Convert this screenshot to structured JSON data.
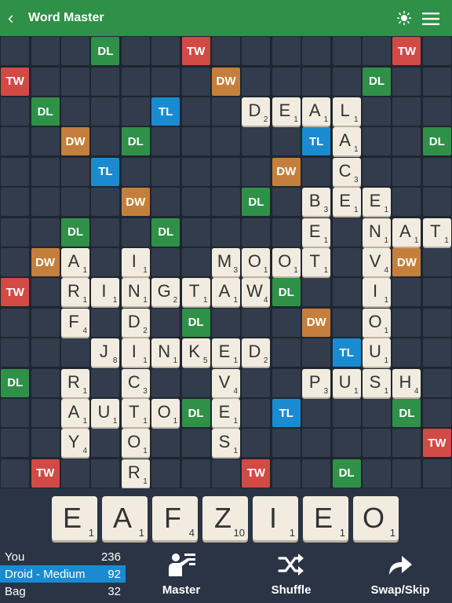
{
  "header": {
    "title": "Word Master",
    "back_icon": "chevron-left-icon",
    "theme_icon": "sun-icon",
    "menu_icon": "menu-icon"
  },
  "board": {
    "size": 15,
    "premium_colors": {
      "TW": "#d14a45",
      "DW": "#c47f3c",
      "TL": "#1a8bd1",
      "DL": "#2f9048"
    },
    "premium_squares": [
      {
        "row": 0,
        "col": 3,
        "type": "DL"
      },
      {
        "row": 0,
        "col": 6,
        "type": "TW"
      },
      {
        "row": 0,
        "col": 13,
        "type": "TW"
      },
      {
        "row": 1,
        "col": 0,
        "type": "TW"
      },
      {
        "row": 1,
        "col": 7,
        "type": "DW"
      },
      {
        "row": 1,
        "col": 12,
        "type": "DL"
      },
      {
        "row": 2,
        "col": 1,
        "type": "DL"
      },
      {
        "row": 2,
        "col": 5,
        "type": "TL"
      },
      {
        "row": 3,
        "col": 2,
        "type": "DW"
      },
      {
        "row": 3,
        "col": 4,
        "type": "DL"
      },
      {
        "row": 3,
        "col": 10,
        "type": "TL"
      },
      {
        "row": 3,
        "col": 14,
        "type": "DL"
      },
      {
        "row": 4,
        "col": 3,
        "type": "TL"
      },
      {
        "row": 4,
        "col": 9,
        "type": "DW"
      },
      {
        "row": 5,
        "col": 4,
        "type": "DW"
      },
      {
        "row": 5,
        "col": 8,
        "type": "DL"
      },
      {
        "row": 6,
        "col": 2,
        "type": "DL"
      },
      {
        "row": 6,
        "col": 5,
        "type": "DL"
      },
      {
        "row": 7,
        "col": 1,
        "type": "DW"
      },
      {
        "row": 7,
        "col": 13,
        "type": "DW"
      },
      {
        "row": 8,
        "col": 0,
        "type": "TW"
      },
      {
        "row": 8,
        "col": 9,
        "type": "DL"
      },
      {
        "row": 9,
        "col": 6,
        "type": "DL"
      },
      {
        "row": 9,
        "col": 10,
        "type": "DW"
      },
      {
        "row": 10,
        "col": 11,
        "type": "TL"
      },
      {
        "row": 11,
        "col": 0,
        "type": "DL"
      },
      {
        "row": 12,
        "col": 6,
        "type": "DL"
      },
      {
        "row": 12,
        "col": 9,
        "type": "TL"
      },
      {
        "row": 12,
        "col": 13,
        "type": "DL"
      },
      {
        "row": 13,
        "col": 14,
        "type": "TW"
      },
      {
        "row": 14,
        "col": 1,
        "type": "TW"
      },
      {
        "row": 14,
        "col": 8,
        "type": "TW"
      },
      {
        "row": 14,
        "col": 11,
        "type": "DL"
      }
    ],
    "tiles": [
      {
        "row": 2,
        "col": 8,
        "letter": "D",
        "value": "2"
      },
      {
        "row": 2,
        "col": 9,
        "letter": "E",
        "value": "1"
      },
      {
        "row": 2,
        "col": 10,
        "letter": "A",
        "value": "1"
      },
      {
        "row": 2,
        "col": 11,
        "letter": "L",
        "value": "1"
      },
      {
        "row": 3,
        "col": 11,
        "letter": "A",
        "value": "1"
      },
      {
        "row": 4,
        "col": 11,
        "letter": "C",
        "value": "3"
      },
      {
        "row": 5,
        "col": 10,
        "letter": "B",
        "value": "3"
      },
      {
        "row": 5,
        "col": 11,
        "letter": "E",
        "value": "1"
      },
      {
        "row": 5,
        "col": 12,
        "letter": "E",
        "value": "1"
      },
      {
        "row": 6,
        "col": 10,
        "letter": "E",
        "value": "1"
      },
      {
        "row": 6,
        "col": 12,
        "letter": "N",
        "value": "1"
      },
      {
        "row": 6,
        "col": 13,
        "letter": "A",
        "value": "1"
      },
      {
        "row": 6,
        "col": 14,
        "letter": "T",
        "value": "1"
      },
      {
        "row": 7,
        "col": 2,
        "letter": "A",
        "value": "1"
      },
      {
        "row": 7,
        "col": 4,
        "letter": "I",
        "value": "1"
      },
      {
        "row": 7,
        "col": 7,
        "letter": "M",
        "value": "3"
      },
      {
        "row": 7,
        "col": 8,
        "letter": "O",
        "value": "1"
      },
      {
        "row": 7,
        "col": 9,
        "letter": "O",
        "value": "1"
      },
      {
        "row": 7,
        "col": 10,
        "letter": "T",
        "value": "1"
      },
      {
        "row": 7,
        "col": 12,
        "letter": "V",
        "value": "4"
      },
      {
        "row": 8,
        "col": 2,
        "letter": "R",
        "value": "1"
      },
      {
        "row": 8,
        "col": 3,
        "letter": "I",
        "value": "1"
      },
      {
        "row": 8,
        "col": 4,
        "letter": "N",
        "value": "1"
      },
      {
        "row": 8,
        "col": 5,
        "letter": "G",
        "value": "2"
      },
      {
        "row": 8,
        "col": 6,
        "letter": "T",
        "value": "1"
      },
      {
        "row": 8,
        "col": 7,
        "letter": "A",
        "value": "1"
      },
      {
        "row": 8,
        "col": 8,
        "letter": "W",
        "value": "4"
      },
      {
        "row": 8,
        "col": 12,
        "letter": "I",
        "value": "1"
      },
      {
        "row": 9,
        "col": 2,
        "letter": "F",
        "value": "4"
      },
      {
        "row": 9,
        "col": 4,
        "letter": "D",
        "value": "2"
      },
      {
        "row": 9,
        "col": 12,
        "letter": "O",
        "value": "1"
      },
      {
        "row": 10,
        "col": 3,
        "letter": "J",
        "value": "8"
      },
      {
        "row": 10,
        "col": 4,
        "letter": "I",
        "value": "1"
      },
      {
        "row": 10,
        "col": 5,
        "letter": "N",
        "value": "1"
      },
      {
        "row": 10,
        "col": 6,
        "letter": "K",
        "value": "5"
      },
      {
        "row": 10,
        "col": 7,
        "letter": "E",
        "value": "1"
      },
      {
        "row": 10,
        "col": 8,
        "letter": "D",
        "value": "2"
      },
      {
        "row": 10,
        "col": 12,
        "letter": "U",
        "value": "1"
      },
      {
        "row": 11,
        "col": 2,
        "letter": "R",
        "value": "1"
      },
      {
        "row": 11,
        "col": 4,
        "letter": "C",
        "value": "3"
      },
      {
        "row": 11,
        "col": 7,
        "letter": "V",
        "value": "4"
      },
      {
        "row": 11,
        "col": 10,
        "letter": "P",
        "value": "3"
      },
      {
        "row": 11,
        "col": 11,
        "letter": "U",
        "value": "1"
      },
      {
        "row": 11,
        "col": 12,
        "letter": "S",
        "value": "1"
      },
      {
        "row": 11,
        "col": 13,
        "letter": "H",
        "value": "4"
      },
      {
        "row": 12,
        "col": 2,
        "letter": "A",
        "value": "1"
      },
      {
        "row": 12,
        "col": 3,
        "letter": "U",
        "value": "1"
      },
      {
        "row": 12,
        "col": 4,
        "letter": "T",
        "value": "1"
      },
      {
        "row": 12,
        "col": 5,
        "letter": "O",
        "value": "1"
      },
      {
        "row": 12,
        "col": 7,
        "letter": "E",
        "value": "1"
      },
      {
        "row": 13,
        "col": 2,
        "letter": "Y",
        "value": "4"
      },
      {
        "row": 13,
        "col": 4,
        "letter": "O",
        "value": "1"
      },
      {
        "row": 13,
        "col": 7,
        "letter": "S",
        "value": "1"
      },
      {
        "row": 14,
        "col": 4,
        "letter": "R",
        "value": "1"
      }
    ]
  },
  "rack": [
    {
      "letter": "E",
      "value": "1"
    },
    {
      "letter": "A",
      "value": "1"
    },
    {
      "letter": "F",
      "value": "4"
    },
    {
      "letter": "Z",
      "value": "10"
    },
    {
      "letter": "I",
      "value": "1"
    },
    {
      "letter": "E",
      "value": "1"
    },
    {
      "letter": "O",
      "value": "1"
    }
  ],
  "scores": [
    {
      "name": "You",
      "score": "236",
      "active": false
    },
    {
      "name": "Droid - Medium",
      "score": "92",
      "active": true
    },
    {
      "name": "Bag",
      "score": "32",
      "active": false
    }
  ],
  "actions": [
    {
      "label": "Master",
      "icon": "master-icon"
    },
    {
      "label": "Shuffle",
      "icon": "shuffle-icon"
    },
    {
      "label": "Swap/Skip",
      "icon": "swap-icon"
    }
  ]
}
